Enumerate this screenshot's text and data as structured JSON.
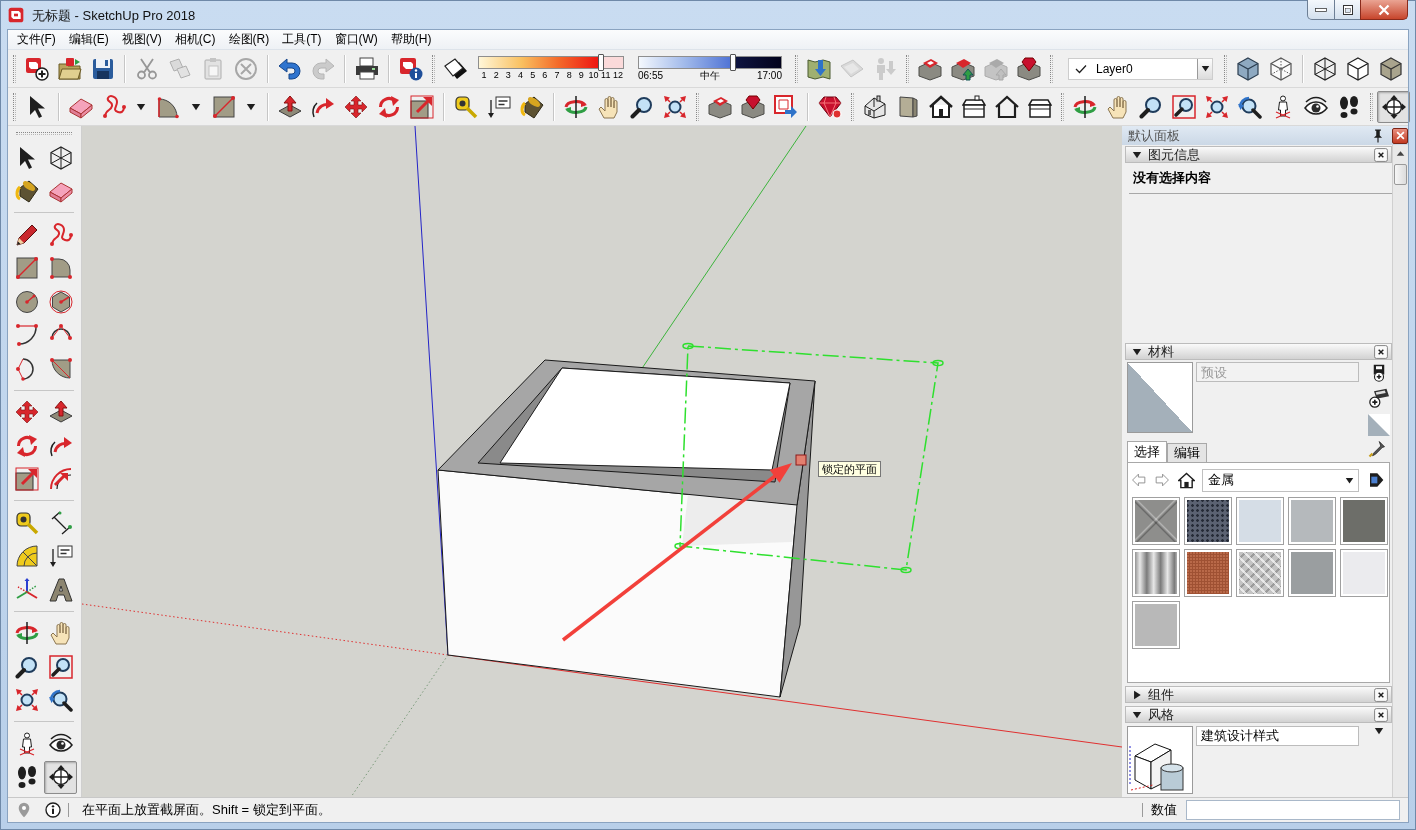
{
  "window": {
    "title": "无标题 - SketchUp Pro 2018"
  },
  "menu": [
    "文件(F)",
    "编辑(E)",
    "视图(V)",
    "相机(C)",
    "绘图(R)",
    "工具(T)",
    "窗口(W)",
    "帮助(H)"
  ],
  "top_toolbar": {
    "tools": [
      {
        "disabled": false
      },
      {
        "disabled": false
      },
      {
        "disabled": false
      },
      {
        "disabled": true
      },
      {
        "disabled": true
      },
      {
        "disabled": true
      },
      {
        "disabled": true
      },
      {
        "disabled": false
      },
      {
        "disabled": true
      },
      {
        "disabled": false
      },
      {
        "disabled": false
      },
      {
        "disabled": false
      },
      {
        "disabled": false
      },
      {
        "disabled": true
      },
      {
        "disabled": true
      },
      {
        "disabled": false
      },
      {
        "disabled": false
      },
      {
        "disabled": true
      },
      {
        "disabled": false
      },
      {
        "disabled": false
      },
      {
        "disabled": false
      },
      {
        "disabled": false
      },
      {
        "disabled": false
      },
      {
        "disabled": false
      }
    ],
    "shadows": {
      "month_slider": {
        "level": 0.85,
        "labels": [
          "1",
          "2",
          "3",
          "4",
          "5",
          "6",
          "7",
          "8",
          "9",
          "10",
          "11",
          "12"
        ]
      },
      "time_slider": {
        "level": 0.66,
        "labels": [
          "06:55",
          "中午",
          "17:00"
        ]
      }
    },
    "layer": {
      "name": "Layer0",
      "checked": true
    }
  },
  "tool_toolbar": {
    "tools": [
      {
        "selected": false
      },
      {
        "selected": false
      },
      {
        "selected": false
      },
      {
        "selected": false
      },
      {
        "selected": false
      },
      {
        "selected": false
      },
      {
        "selected": false
      },
      {
        "selected": false
      },
      {
        "selected": false
      },
      {
        "selected": false
      },
      {
        "selected": false
      },
      {
        "selected": false
      },
      {
        "selected": false
      },
      {
        "selected": false
      },
      {
        "selected": false
      },
      {
        "selected": false
      },
      {
        "selected": false
      },
      {
        "selected": false
      },
      {
        "selected": false
      },
      {
        "selected": false
      },
      {
        "selected": false
      },
      {
        "selected": false
      },
      {
        "selected": false
      },
      {
        "selected": false
      },
      {
        "selected": false
      },
      {
        "selected": false
      },
      {
        "selected": false
      },
      {
        "selected": false
      },
      {
        "selected": false
      },
      {
        "selected": false
      },
      {
        "selected": false
      },
      {
        "selected": false
      },
      {
        "selected": false
      },
      {
        "selected": false
      },
      {
        "selected": false
      },
      {
        "selected": false
      },
      {
        "selected": true
      }
    ]
  },
  "left_toolbar": {
    "tools": [
      {
        "selected": false
      },
      {
        "selected": false
      },
      {
        "selected": false
      },
      {
        "selected": false
      },
      {
        "selected": false
      },
      {
        "selected": false
      },
      {
        "selected": false
      },
      {
        "selected": false
      },
      {
        "selected": false
      },
      {
        "selected": false
      },
      {
        "selected": false
      },
      {
        "selected": false
      },
      {
        "selected": false
      },
      {
        "selected": false
      },
      {
        "selected": false
      },
      {
        "selected": false
      },
      {
        "selected": false
      },
      {
        "selected": false
      },
      {
        "selected": false
      },
      {
        "selected": false
      },
      {
        "selected": false
      },
      {
        "selected": false
      },
      {
        "selected": false
      },
      {
        "selected": false
      },
      {
        "selected": false
      },
      {
        "selected": false
      },
      {
        "selected": false
      },
      {
        "selected": false
      },
      {
        "selected": false
      },
      {
        "selected": false
      },
      {
        "selected": false
      },
      {
        "selected": false
      },
      {
        "selected": false
      },
      {
        "selected": false
      },
      {
        "selected": false
      },
      {
        "selected": true
      }
    ]
  },
  "viewport": {
    "tooltip": "锁定的平面"
  },
  "tray": {
    "title": "默认面板",
    "entity_info": {
      "title": "图元信息",
      "expanded": true,
      "message": "没有选择内容"
    },
    "materials": {
      "title": "材料",
      "expanded": true,
      "name_field": {
        "placeholder": "预设"
      },
      "tabs": [
        {
          "label": "选择",
          "selected": true
        },
        {
          "label": "编辑",
          "selected": false
        }
      ],
      "collection": "金属",
      "swatches": [
        {
          "color": "#8e8e8c",
          "kind": "cross"
        },
        {
          "color": "#5b6272",
          "kind": "dots"
        },
        {
          "color": "#d5dde6",
          "kind": "plain"
        },
        {
          "color": "#b5b9bc",
          "kind": "plain"
        },
        {
          "color": "#6d6e69",
          "kind": "plain"
        },
        {
          "color": "#b0b0b0",
          "kind": "stripes"
        },
        {
          "color": "#bf6f4f",
          "kind": "grain"
        },
        {
          "color": "#c4c4c4",
          "kind": "diamond"
        },
        {
          "color": "#9a9ea0",
          "kind": "plain"
        },
        {
          "color": "#ebebee",
          "kind": "plain"
        },
        {
          "color": "#b8b8b8",
          "kind": "plain"
        }
      ]
    },
    "components": {
      "title": "组件",
      "expanded": false
    },
    "styles": {
      "title": "风格",
      "expanded": true,
      "style_name": "建筑设计样式"
    }
  },
  "status_bar": {
    "message": "在平面上放置截屏面。Shift = 锁定到平面。",
    "measure_label": "数值"
  }
}
